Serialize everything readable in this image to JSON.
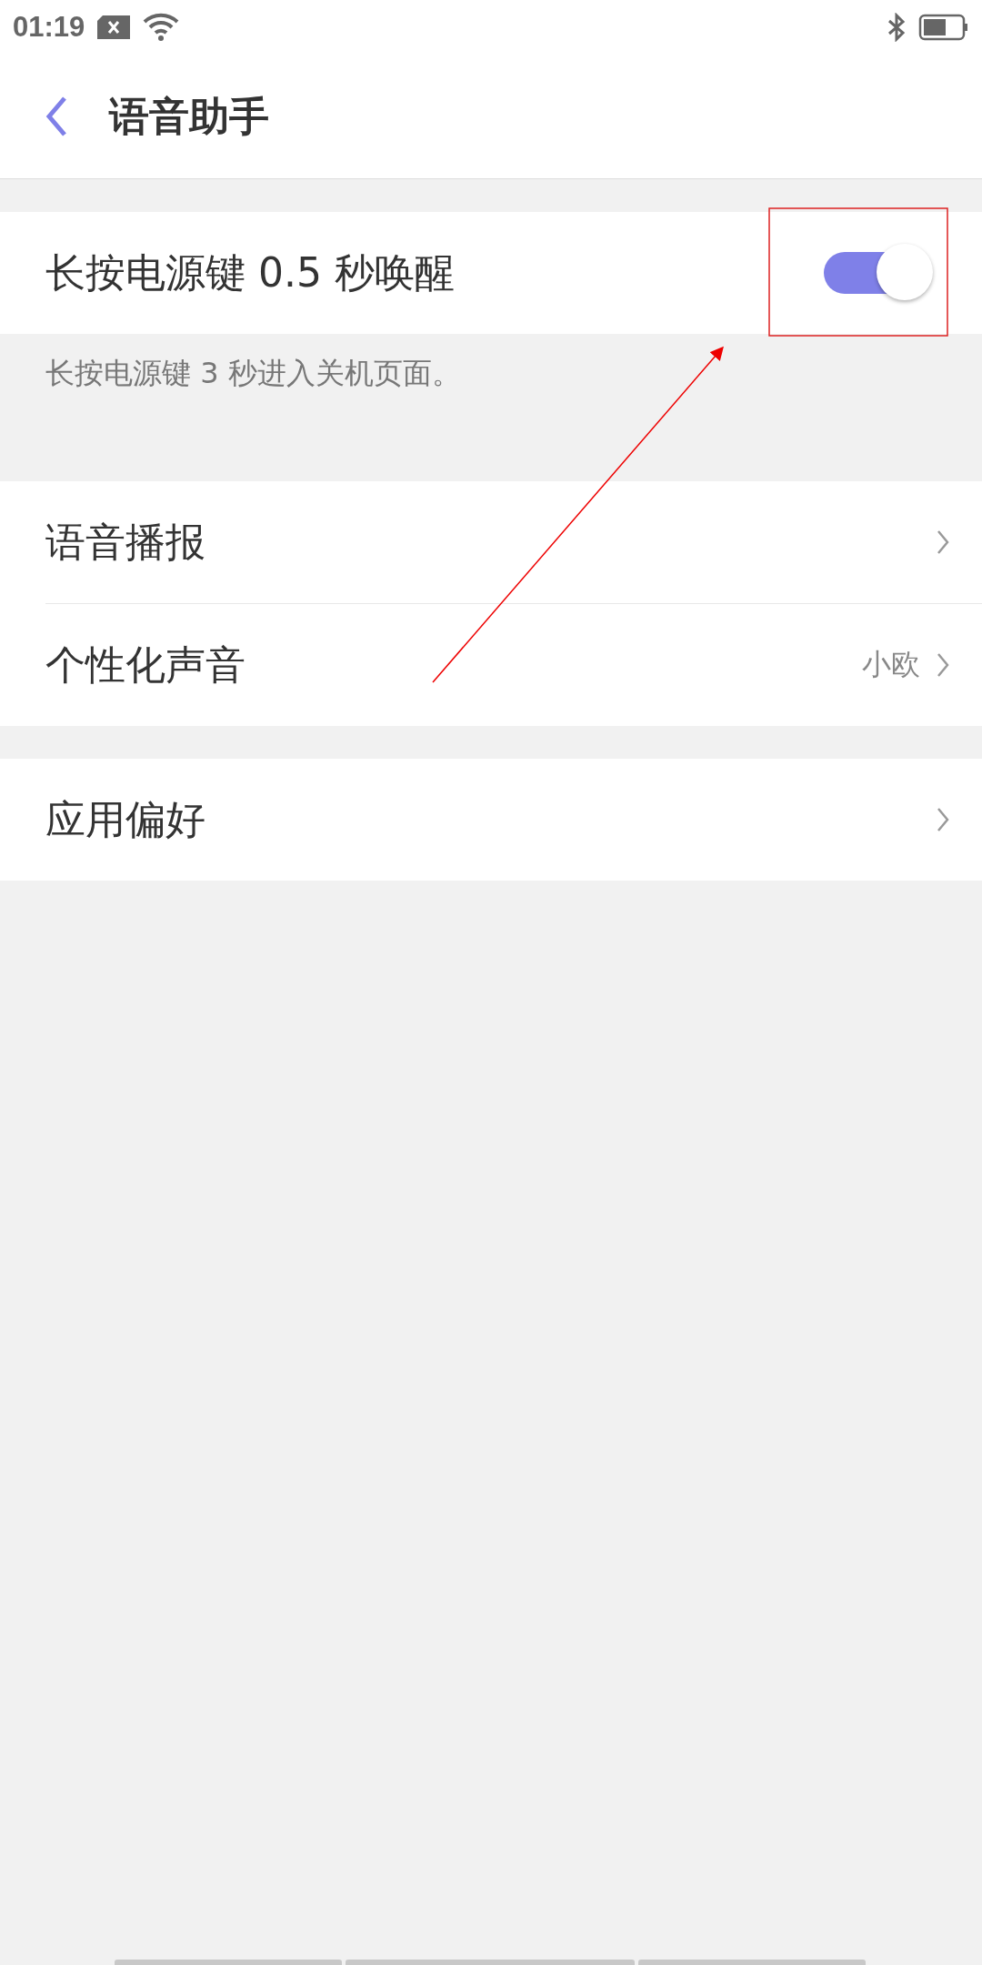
{
  "status_bar": {
    "time": "01:19"
  },
  "header": {
    "title": "语音助手"
  },
  "sections": [
    {
      "rows": [
        {
          "kind": "switch",
          "label": "长按电源键 0.5 秒唤醒",
          "on": true
        }
      ],
      "note": "长按电源键 3 秒进入关机页面。"
    },
    {
      "rows": [
        {
          "kind": "link",
          "label": "语音播报"
        },
        {
          "kind": "link",
          "label": "个性化声音",
          "value": "小欧"
        }
      ]
    },
    {
      "rows": [
        {
          "kind": "link",
          "label": "应用偏好"
        }
      ]
    }
  ]
}
